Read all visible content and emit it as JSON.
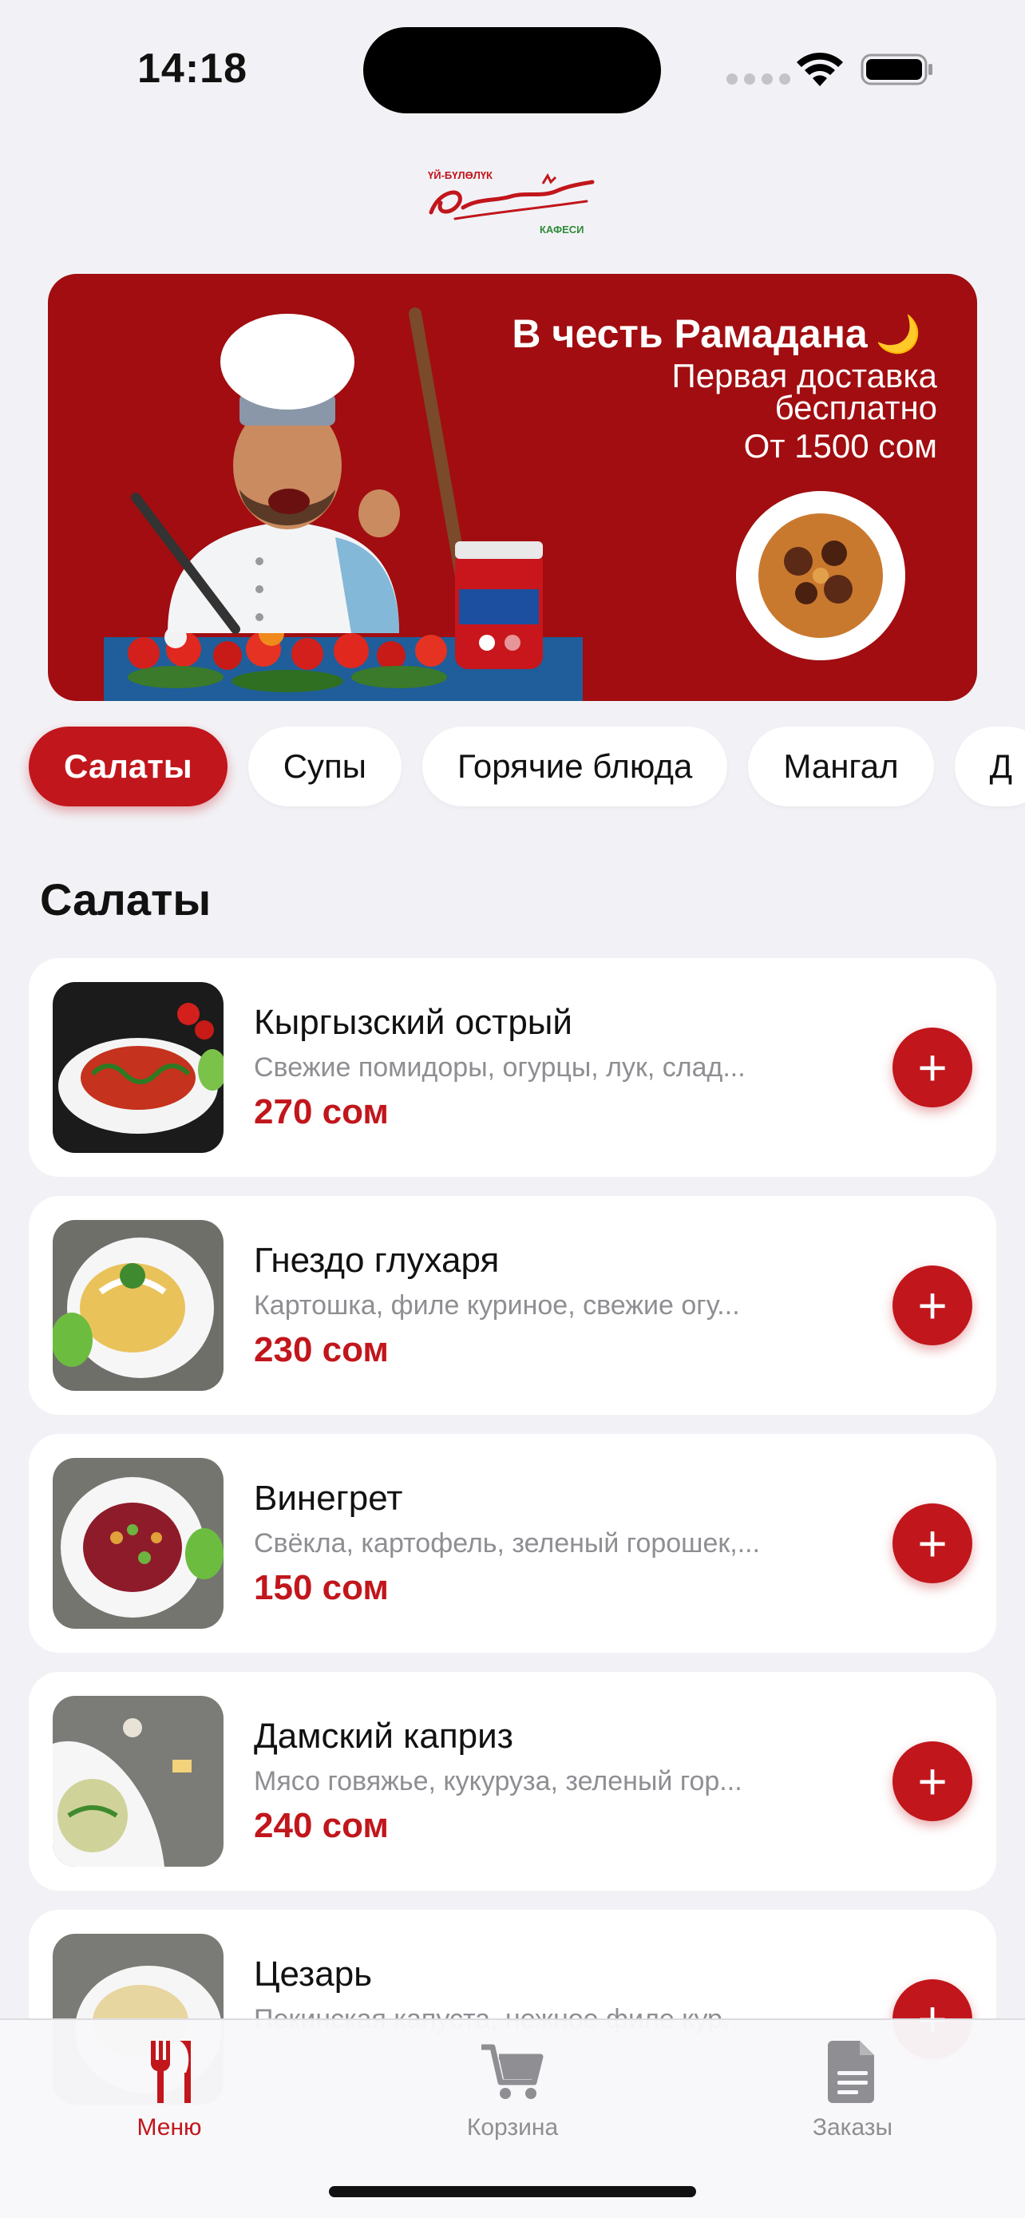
{
  "status_bar": {
    "time": "14:18"
  },
  "banner": {
    "title": "В честь Рамадана",
    "moon": "🌙",
    "line1": "Первая доставка",
    "line2": "бесплатно",
    "line3": "От 1500 сом"
  },
  "categories": [
    {
      "label": "Салаты",
      "active": true
    },
    {
      "label": "Супы"
    },
    {
      "label": "Горячие блюда"
    },
    {
      "label": "Мангал"
    },
    {
      "label": "Д"
    }
  ],
  "section_title": "Салаты",
  "items": [
    {
      "name": "Кыргызский острый",
      "desc": "Свежие помидоры, огурцы, лук, слад...",
      "price": "270 сом",
      "add": "+"
    },
    {
      "name": "Гнездо глухаря",
      "desc": "Картошка, филе куриное, свежие огу...",
      "price": "230 сом",
      "add": "+"
    },
    {
      "name": "Винегрет",
      "desc": "Свёкла, картофель, зеленый горошек,...",
      "price": "150 сом",
      "add": "+"
    },
    {
      "name": "Дамский каприз",
      "desc": "Мясо говяжье, кукуруза, зеленый гор...",
      "price": "240 сом",
      "add": "+"
    },
    {
      "name": "Цезарь",
      "desc": "Пекинская капуста, нежное филе кур...",
      "price": "",
      "add": "+"
    }
  ],
  "tabs": [
    {
      "label": "Меню",
      "icon": "fork-knife-icon",
      "active": true
    },
    {
      "label": "Корзина",
      "icon": "cart-icon"
    },
    {
      "label": "Заказы",
      "icon": "document-icon"
    }
  ],
  "colors": {
    "accent": "#c1161c",
    "banner": "#a10d10",
    "background": "#f2f2f6"
  }
}
